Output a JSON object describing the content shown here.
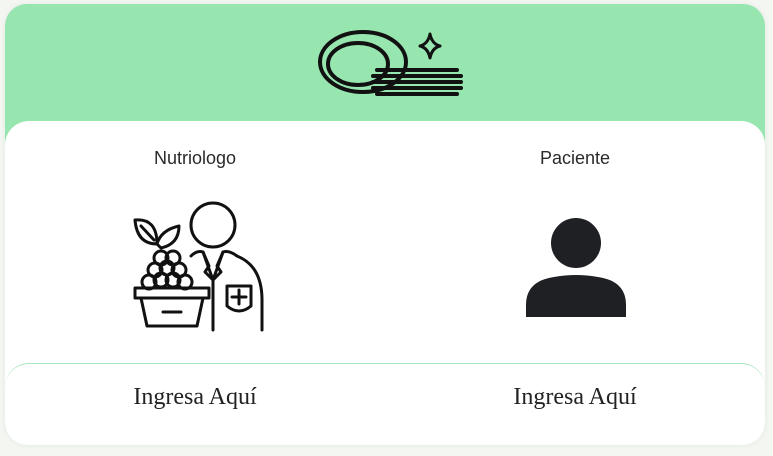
{
  "header": {
    "logo_icon": "plates-stack-icon",
    "background": "#97e6b0"
  },
  "roles": [
    {
      "title": "Nutriologo",
      "icon": "nutritionist-icon",
      "action_label": "Ingresa Aquí"
    },
    {
      "title": "Paciente",
      "icon": "person-icon",
      "action_label": "Ingresa Aquí"
    }
  ]
}
